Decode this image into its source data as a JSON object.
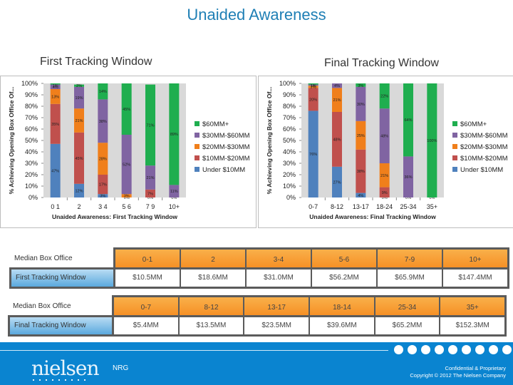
{
  "page": {
    "title": "Unaided Awareness",
    "left_subtitle": "First Tracking Window",
    "right_subtitle": "Final Tracking Window"
  },
  "colors": {
    "under_10": "#4f81bd",
    "10_20": "#c0504d",
    "20_30": "#f07f1b",
    "30_60": "#8064a2",
    "60_plus": "#1fae4f",
    "plot_bg": "#d9d9d9"
  },
  "chart_data": [
    {
      "type": "bar",
      "stacked": true,
      "title": "",
      "xlabel": "Unaided Awareness: First Tracking Window",
      "ylabel": "% Achieving Opening Box Office Of...",
      "ylim": [
        0,
        100
      ],
      "yticks": [
        "0%",
        "10%",
        "20%",
        "30%",
        "40%",
        "50%",
        "60%",
        "70%",
        "80%",
        "90%",
        "100%"
      ],
      "categories": [
        "0 1",
        "2",
        "3 4",
        "5 6",
        "7 9",
        "10+"
      ],
      "legend_position": "right",
      "series": [
        {
          "name": "Under $10MM",
          "key": "under_10",
          "values": [
            47,
            12,
            3,
            0,
            0,
            0
          ]
        },
        {
          "name": "$10MM-$20MM",
          "key": "10_20",
          "values": [
            35,
            45,
            17,
            0,
            7,
            0
          ]
        },
        {
          "name": "$20MM-$30MM",
          "key": "20_30",
          "values": [
            13,
            21,
            28,
            3,
            0,
            0
          ]
        },
        {
          "name": "$30MM-$60MM",
          "key": "30_60",
          "values": [
            4,
            19,
            38,
            52,
            21,
            11
          ]
        },
        {
          "name": "$60MM+",
          "key": "60_plus",
          "values": [
            1,
            2,
            14,
            45,
            71,
            89
          ]
        }
      ],
      "legend_order": [
        "$60MM+",
        "$30MM-$60MM",
        "$20MM-$30MM",
        "$10MM-$20MM",
        "Under $10MM"
      ]
    },
    {
      "type": "bar",
      "stacked": true,
      "title": "",
      "xlabel": "Unaided Awareness: Final Tracking Window",
      "ylabel": "% Achieving Opening Box Office Of...",
      "ylim": [
        0,
        100
      ],
      "yticks": [
        "0%",
        "10%",
        "20%",
        "30%",
        "40%",
        "50%",
        "60%",
        "70%",
        "80%",
        "90%",
        "100%"
      ],
      "categories": [
        "0-7",
        "8-12",
        "13-17",
        "18-24",
        "25-34",
        "35+"
      ],
      "legend_position": "right",
      "series": [
        {
          "name": "Under $10MM",
          "key": "under_10",
          "values": [
            76,
            27,
            4,
            0,
            0,
            0
          ]
        },
        {
          "name": "$10MM-$20MM",
          "key": "10_20",
          "values": [
            20,
            48,
            38,
            9,
            0,
            0
          ]
        },
        {
          "name": "$20MM-$30MM",
          "key": "20_30",
          "values": [
            2,
            21,
            25,
            21,
            0,
            0
          ]
        },
        {
          "name": "$30MM-$60MM",
          "key": "30_60",
          "values": [
            1,
            4,
            30,
            48,
            36,
            0
          ]
        },
        {
          "name": "$60MM+",
          "key": "60_plus",
          "values": [
            1,
            0,
            3,
            22,
            64,
            100
          ]
        }
      ],
      "legend_order": [
        "$60MM+",
        "$30MM-$60MM",
        "$20MM-$30MM",
        "$10MM-$20MM",
        "Under $10MM"
      ]
    }
  ],
  "table": {
    "first": {
      "header_label": "Median Box Office",
      "row_label": "First Tracking Window",
      "headers": [
        "0-1",
        "2",
        "3-4",
        "5-6",
        "7-9",
        "10+"
      ],
      "values": [
        "$10.5MM",
        "$18.6MM",
        "$31.0MM",
        "$56.2MM",
        "$65.9MM",
        "$147.4MM"
      ]
    },
    "final": {
      "header_label": "Median Box Office",
      "row_label": "Final Tracking Window",
      "headers": [
        "0-7",
        "8-12",
        "13-17",
        "18-14",
        "25-34",
        "35+"
      ],
      "values": [
        "$5.4MM",
        "$13.5MM",
        "$23.5MM",
        "$39.6MM",
        "$65.2MM",
        "$152.3MM"
      ]
    }
  },
  "footer": {
    "logo": "nielsen",
    "label": "NRG",
    "confidential": "Confidential & Proprietary",
    "copyright": "Copyright © 2012 The Nielsen Company"
  }
}
